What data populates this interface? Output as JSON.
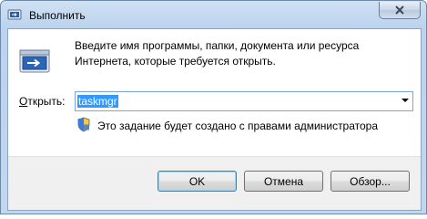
{
  "window": {
    "title": "Выполнить"
  },
  "dialog": {
    "description": "Введите имя программы, папки, документа или ресурса Интернета, которые требуется открыть.",
    "open_label_first": "О",
    "open_label_rest": "ткрыть:",
    "command_value": "taskmgr",
    "admin_notice": "Это задание будет создано с правами администратора"
  },
  "buttons": {
    "ok": "OK",
    "cancel": "Отмена",
    "browse": "Обзор..."
  },
  "icons": {
    "title": "run-icon",
    "main": "run-icon",
    "admin": "uac-shield-icon",
    "close": "close-icon",
    "dropdown": "chevron-down-icon"
  },
  "colors": {
    "selection": "#3399ff",
    "close_button": "#c9d6e8",
    "client_bg": "#ffffff",
    "footer_bg": "#f0f0f0"
  }
}
